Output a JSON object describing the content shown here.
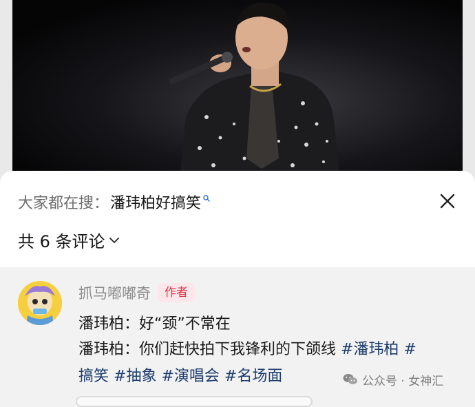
{
  "search": {
    "prefix": "大家都在搜：",
    "term": "潘玮柏好搞笑"
  },
  "comments_header": {
    "count_label": "共 6 条评论"
  },
  "comment": {
    "username": "抓马嘟嘟奇",
    "badge": "作者",
    "line1": "潘玮柏：好“颈”不常在",
    "line2_text": "潘玮柏：你们赶快拍下我锋利的下颌线 ",
    "line2_tags": [
      "#潘玮柏",
      "#"
    ],
    "line3_tags": [
      "搞笑",
      "#抽象",
      "#演唱会",
      "#名场面"
    ]
  },
  "watermark": {
    "label": "公众号 · 女神汇"
  },
  "colors": {
    "badge_bg": "#fde7ea",
    "badge_text": "#e0364a",
    "hashtag": "#1d3c6e"
  },
  "icons": [
    "search-icon",
    "close-icon",
    "chevron-down-icon",
    "wechat-icon"
  ]
}
